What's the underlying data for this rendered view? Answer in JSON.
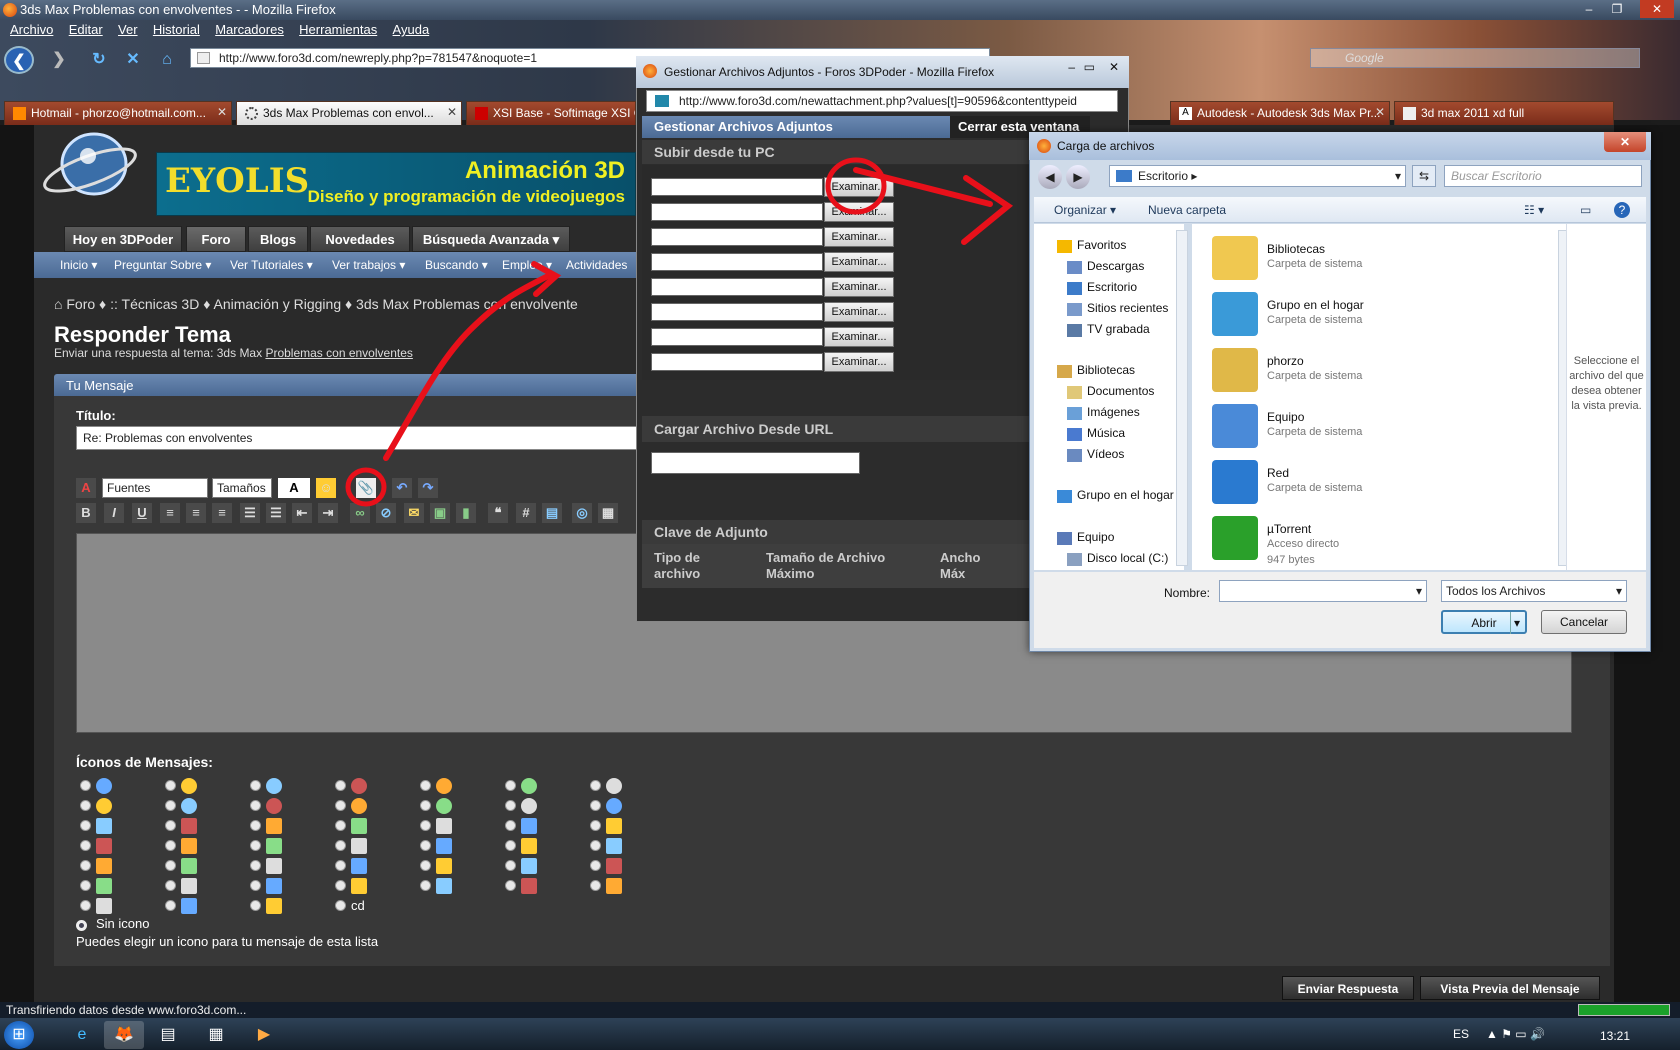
{
  "browser": {
    "window_title": "3ds Max Problemas con envolventes - - Mozilla Firefox",
    "menu": [
      "Archivo",
      "Editar",
      "Ver",
      "Historial",
      "Marcadores",
      "Herramientas",
      "Ayuda"
    ],
    "url": "http://www.foro3d.com/newreply.php?p=781547&noquote=1",
    "search_placeholder": "Google",
    "tabs": [
      {
        "label": "Hotmail - phorzo@hotmail.com...",
        "active": false
      },
      {
        "label": "3ds Max Problemas con envol...",
        "active": true
      },
      {
        "label": "XSI Base - Softimage XSI C...",
        "active": false
      },
      {
        "label": "Autodesk - Autodesk 3ds Max Pr...",
        "active": false
      },
      {
        "label": "3d max 2011 xd full",
        "active": false
      }
    ],
    "status_text": "Transfiriendo datos desde www.foro3d.com..."
  },
  "site": {
    "ad_brand": "EYOLIS",
    "ad_line1": "Animación 3D",
    "ad_line2": "Diseño y programación de videojuegos",
    "nav_tabs": [
      "Hoy en 3DPoder",
      "Foro",
      "Blogs",
      "Novedades",
      "Búsqueda Avanzada ▾"
    ],
    "subnav": [
      "Inicio ▾",
      "Preguntar Sobre ▾",
      "Ver Tutoriales ▾",
      "Ver trabajos ▾",
      "Buscando ▾",
      "Empleo ▾",
      "Actividades"
    ],
    "breadcrumb": [
      "Foro",
      "::",
      "Técnicas 3D",
      "Animación y Rigging",
      "3ds Max Problemas con envolvente"
    ]
  },
  "reply": {
    "heading": "Responder Tema",
    "subtitle_prefix": "Enviar una respuesta al tema: 3ds Max",
    "subtitle_link": "Problemas con envolventes",
    "panel_title": "Tu Mensaje",
    "title_label": "Título:",
    "title_value": "Re: Problemas con envolventes",
    "font_select": "Fuentes",
    "size_select": "Tamaños",
    "icons_label": "Íconos de Mensajes:",
    "no_icon": "Sin icono",
    "icons_hint": "Puedes elegir un icono para tu mensaje de esta lista",
    "cd_label": "cd",
    "submit_label": "Enviar Respuesta",
    "preview_label": "Vista Previa del Mensaje"
  },
  "attach_window": {
    "title": "Gestionar Archivos Adjuntos - Foros 3DPoder - Mozilla Firefox",
    "url": "http://www.foro3d.com/newattachment.php?values[t]=90596&contenttypeid",
    "header": "Gestionar Archivos Adjuntos",
    "close_label": "Cerrar esta ventana",
    "upload_header": "Subir desde tu PC",
    "browse_label": "Examinar...",
    "url_header": "Cargar Archivo Desde URL",
    "key_header": "Clave de Adjunto",
    "col_type": "Tipo de archivo",
    "col_size": "Tamaño de Archivo Máximo",
    "col_width": "Ancho Máx"
  },
  "file_dialog": {
    "title": "Carga de archivos",
    "location": "Escritorio",
    "search_placeholder": "Buscar Escritorio",
    "organize": "Organizar ▾",
    "new_folder": "Nueva carpeta",
    "nav_items": [
      "Favoritos",
      "Descargas",
      "Escritorio",
      "Sitios recientes",
      "TV grabada",
      "Bibliotecas",
      "Documentos",
      "Imágenes",
      "Música",
      "Vídeos",
      "Grupo en el hogar",
      "Equipo",
      "Disco local (C:)"
    ],
    "files": [
      {
        "name": "Bibliotecas",
        "sub": "Carpeta de sistema"
      },
      {
        "name": "Grupo en el hogar",
        "sub": "Carpeta de sistema"
      },
      {
        "name": "phorzo",
        "sub": "Carpeta de sistema"
      },
      {
        "name": "Equipo",
        "sub": "Carpeta de sistema"
      },
      {
        "name": "Red",
        "sub": "Carpeta de sistema"
      },
      {
        "name": "µTorrent",
        "sub": "Acceso directo",
        "extra": "947 bytes"
      }
    ],
    "preview_hint": "Seleccione el archivo del que desea obtener la vista previa.",
    "name_label": "Nombre:",
    "filter": "Todos los Archivos",
    "open_label": "Abrir",
    "cancel_label": "Cancelar"
  },
  "taskbar": {
    "lang": "ES",
    "clock": "13:21"
  }
}
